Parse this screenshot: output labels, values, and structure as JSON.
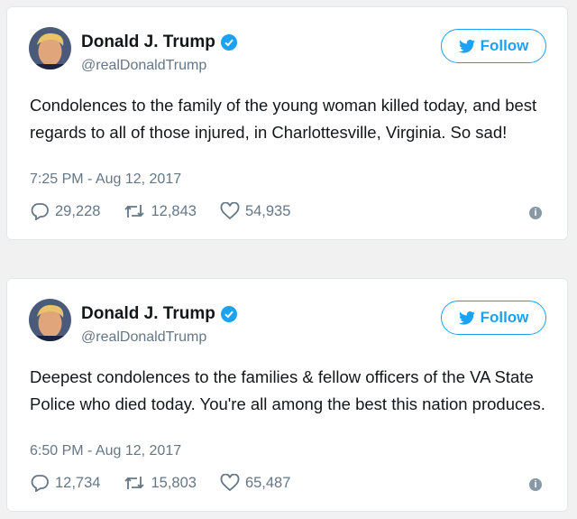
{
  "colors": {
    "accent": "#1da1f2",
    "muted": "#657786",
    "text": "#14171a"
  },
  "tweets": [
    {
      "author": {
        "name": "Donald J. Trump",
        "handle": "@realDonaldTrump",
        "verified": true
      },
      "follow_label": "Follow",
      "text": "Condolences to the family of the young woman killed today, and best regards to all of those injured, in Charlottesville, Virginia. So sad!",
      "timestamp": "7:25 PM - Aug 12, 2017",
      "replies": "29,228",
      "retweets": "12,843",
      "likes": "54,935"
    },
    {
      "author": {
        "name": "Donald J. Trump",
        "handle": "@realDonaldTrump",
        "verified": true
      },
      "follow_label": "Follow",
      "text": "Deepest condolences to the families & fellow officers of the VA State Police who died today. You're all among the best this nation produces.",
      "timestamp": "6:50 PM - Aug 12, 2017",
      "replies": "12,734",
      "retweets": "15,803",
      "likes": "65,487"
    }
  ]
}
